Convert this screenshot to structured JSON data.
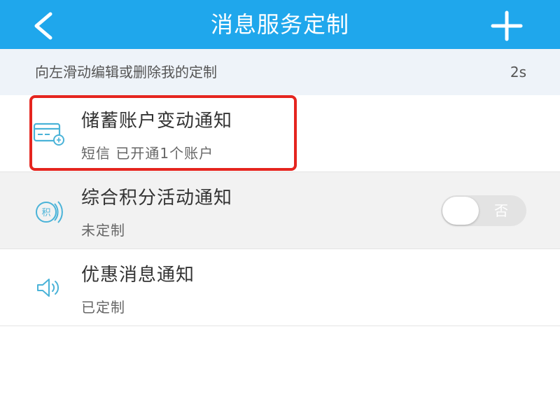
{
  "header": {
    "title": "消息服务定制",
    "back_icon": "chevron-left-icon",
    "add_icon": "plus-icon",
    "background": "#1fa7ec"
  },
  "hint": {
    "text": "向左滑动编辑或删除我的定制",
    "timer": "2s"
  },
  "items": [
    {
      "title": "储蓄账户变动通知",
      "subtitle": "短信  已开通1个账户",
      "icon": "bank-card-icon",
      "highlighted": true
    },
    {
      "title": "综合积分活动通知",
      "subtitle": "未定制",
      "icon": "points-icon",
      "toggle": {
        "label": "否",
        "on": false
      }
    },
    {
      "title": "优惠消息通知",
      "subtitle": "已定制",
      "icon": "speaker-icon"
    }
  ],
  "colors": {
    "accent": "#1fa7ec",
    "icon": "#4ab3d8",
    "highlight": "#e5251f"
  }
}
